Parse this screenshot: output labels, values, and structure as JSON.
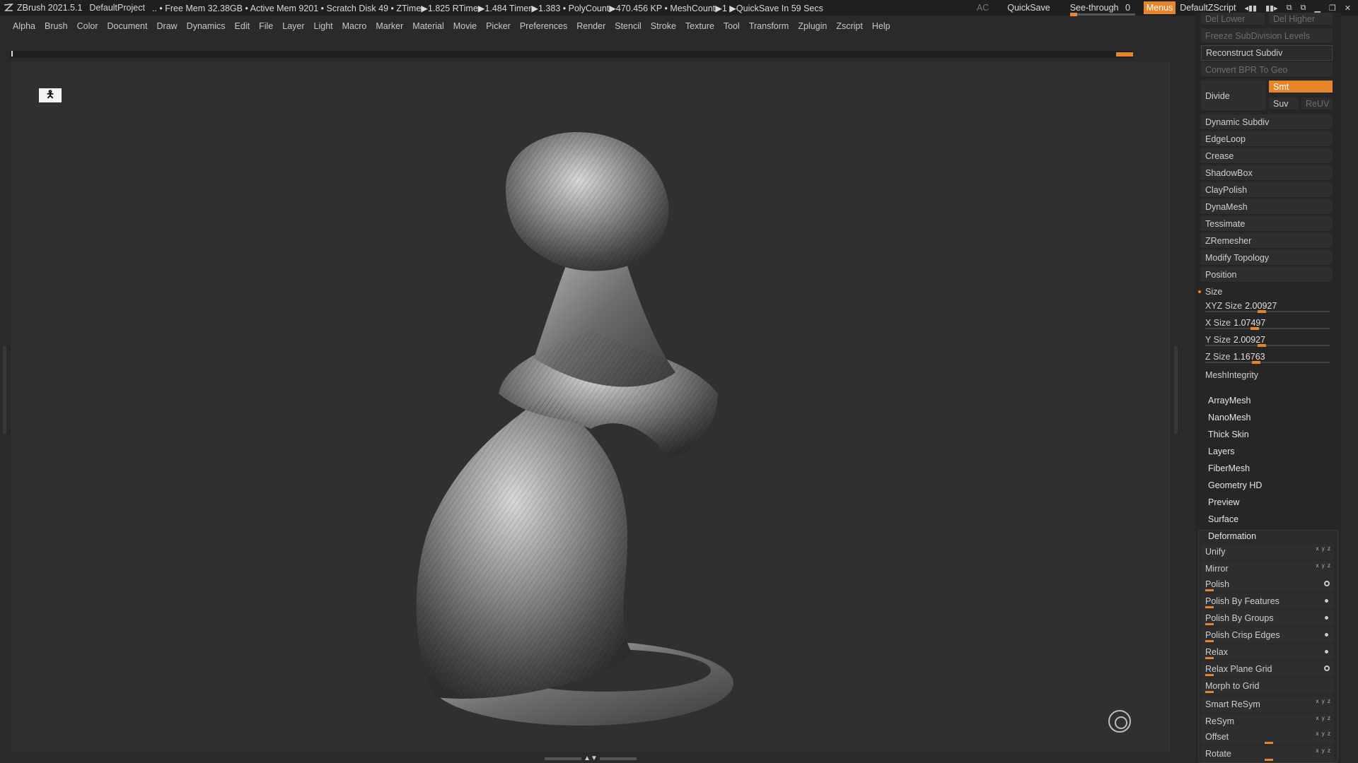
{
  "titlebar": {
    "app": "ZBrush 2021.5.1",
    "project": "DefaultProject",
    "status": ".. • Free Mem 32.38GB • Active Mem 9201 • Scratch Disk 49 •  ZTime▶1.825 RTime▶1.484 Timer▶1.383 • PolyCount▶470.456 KP  • MeshCount▶1  ▶QuickSave In 59 Secs",
    "ac": "AC",
    "quicksave": "QuickSave",
    "seethrough_label": "See-through",
    "seethrough_value": "0",
    "menus": "Menus",
    "defaultzscript": "DefaultZScript"
  },
  "menubar": [
    "Alpha",
    "Brush",
    "Color",
    "Document",
    "Draw",
    "Dynamics",
    "Edit",
    "File",
    "Layer",
    "Light",
    "Macro",
    "Marker",
    "Material",
    "Movie",
    "Picker",
    "Preferences",
    "Render",
    "Stencil",
    "Stroke",
    "Texture",
    "Tool",
    "Transform",
    "Zplugin",
    "Zscript",
    "Help"
  ],
  "panel": {
    "del_lower": "Del Lower",
    "del_higher": "Del Higher",
    "freeze": "Freeze SubDivision Levels",
    "reconstruct": "Reconstruct Subdiv",
    "convert_bpr": "Convert BPR To Geo",
    "divide": "Divide",
    "smt": "Smt",
    "suv": "Suv",
    "reuv": "ReUV",
    "items": [
      "Dynamic Subdiv",
      "EdgeLoop",
      "Crease",
      "ShadowBox",
      "ClayPolish",
      "DynaMesh",
      "Tessimate",
      "ZRemesher",
      "Modify Topology",
      "Position"
    ],
    "size_label": "Size",
    "xyz_size_label": "XYZ Size",
    "xyz_size": "2.00927",
    "x_size_label": "X Size",
    "x_size": "1.07497",
    "y_size_label": "Y Size",
    "y_size": "2.00927",
    "z_size_label": "Z Size",
    "z_size": "1.16763",
    "mesh_integrity": "MeshIntegrity",
    "subtools": [
      "ArrayMesh",
      "NanoMesh",
      "Thick Skin",
      "Layers",
      "FiberMesh",
      "Geometry HD",
      "Preview",
      "Surface"
    ],
    "deformation": "Deformation",
    "deform_items": [
      "Unify",
      "Mirror",
      "Polish",
      "Polish By Features",
      "Polish By Groups",
      "Polish Crisp Edges",
      "Relax",
      "Relax Plane Grid",
      "Morph to Grid",
      "Smart ReSym",
      "ReSym",
      "Offset",
      "Rotate"
    ]
  },
  "colors": {
    "accent": "#e8852a",
    "panel_bg": "#262626",
    "canvas_bg": "#303030"
  }
}
